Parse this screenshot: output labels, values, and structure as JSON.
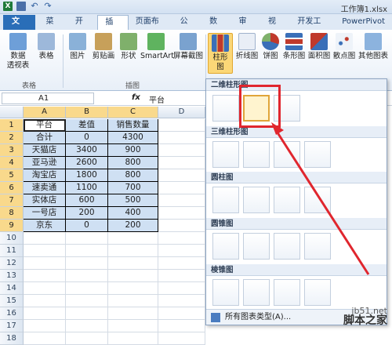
{
  "window": {
    "title": "工作簿1.xlsx"
  },
  "ribbon_tabs": [
    "文件",
    "菜单",
    "开始",
    "插入",
    "页面布局",
    "公式",
    "数据",
    "审阅",
    "视图",
    "开发工具",
    "PowerPivot"
  ],
  "active_tab": "插入",
  "ribbon": {
    "buttons": {
      "pivot": "数据\n透视表",
      "table": "表格",
      "picture": "图片",
      "clipart": "剪贴画",
      "shapes": "形状",
      "smartart": "SmartArt",
      "screenshot": "屏幕截图",
      "column": "柱形图",
      "line": "折线图",
      "pie": "饼图",
      "bar": "条形图",
      "area": "面积图",
      "scatter": "散点图",
      "other": "其他图表"
    },
    "groups": {
      "tables": "表格",
      "illustrations": "插图"
    }
  },
  "formula_bar": {
    "name_box": "A1",
    "fx": "fx",
    "value": "平台"
  },
  "sheet": {
    "columns": [
      "A",
      "B",
      "C",
      "D"
    ],
    "rows": [
      "1",
      "2",
      "3",
      "4",
      "5",
      "6",
      "7",
      "8",
      "9",
      "10",
      "11",
      "12",
      "13",
      "14",
      "15",
      "16",
      "17",
      "18"
    ],
    "data": [
      [
        "平台",
        "差值",
        "销售数量"
      ],
      [
        "合计",
        "0",
        "4300"
      ],
      [
        "天猫店",
        "3400",
        "900"
      ],
      [
        "亚马逊",
        "2600",
        "800"
      ],
      [
        "淘宝店",
        "1800",
        "800"
      ],
      [
        "速卖通",
        "1100",
        "700"
      ],
      [
        "实体店",
        "600",
        "500"
      ],
      [
        "一号店",
        "200",
        "400"
      ],
      [
        "京东",
        "0",
        "200"
      ]
    ]
  },
  "gallery": {
    "sections": [
      "二维柱形图",
      "三维柱形图",
      "圆柱图",
      "圆锥图",
      "棱锥图"
    ],
    "footer": "所有图表类型(A)..."
  },
  "watermark": {
    "site": "jb51.net",
    "name": "脚本之家"
  },
  "colors": {
    "accent": "#2a6eb8",
    "highlight": "#e0262e",
    "selection": "#fbd777"
  }
}
